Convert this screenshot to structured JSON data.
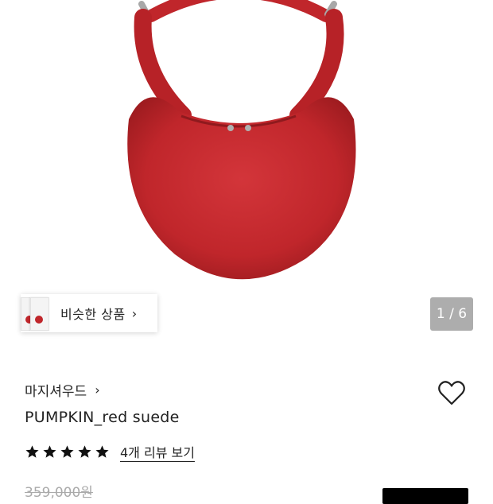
{
  "gallery": {
    "similar_label": "비슷한 상품",
    "page_current": "1",
    "page_total": "6",
    "page_separator": " / "
  },
  "product": {
    "brand": "마지셔우드",
    "name": "PUMPKIN_red suede",
    "rating": 5,
    "review_link": "4개 리뷰 보기",
    "original_price": "359,000원"
  },
  "colors": {
    "bag_red": "#c0262b",
    "counter_bg": "#6e6e6e"
  },
  "icons": {
    "brand_chevron": "chevron-right-icon",
    "wishlist": "heart-outline-icon",
    "star": "star-filled-icon"
  }
}
